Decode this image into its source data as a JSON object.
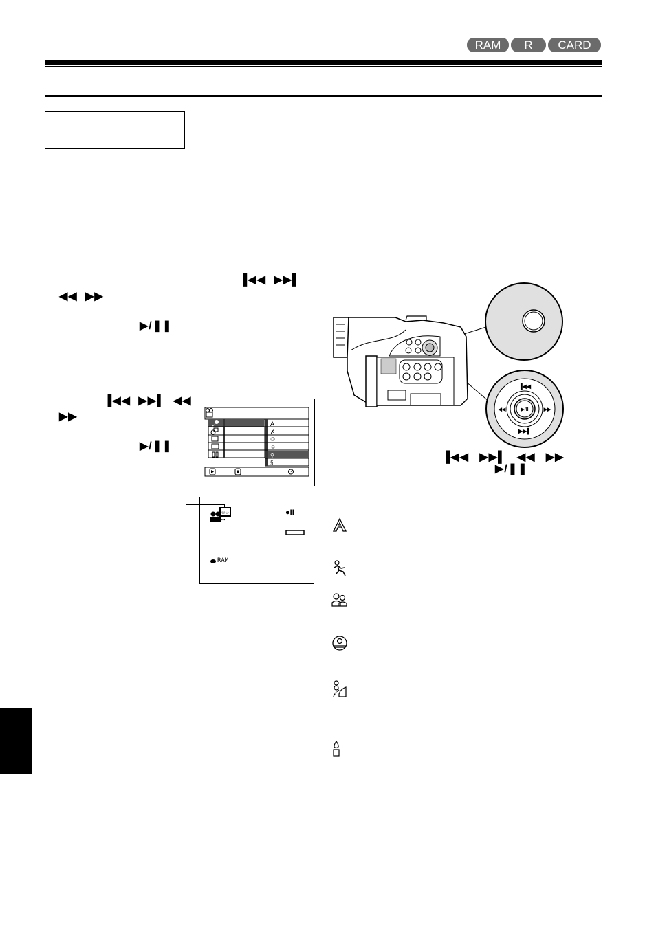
{
  "header": {
    "media_badges": [
      "RAM",
      "R",
      "CARD"
    ]
  },
  "title_box": {
    "text": ""
  },
  "symbols": {
    "skip_back": "⏮",
    "skip_forward": "⏭",
    "rewind": "⏪",
    "fast_forward": "⏩",
    "play_pause": "▶/❚❚"
  },
  "step1": {
    "symbols_line1": [
      "▐◀◀",
      "▶▶▌"
    ],
    "symbols_line2": [
      "◀◀",
      "▶▶"
    ],
    "play_pause": "▶/❚❚"
  },
  "step2": {
    "symbols_line1": [
      "▐◀◀",
      "▶▶▌",
      "◀◀"
    ],
    "symbols_line2": [
      "▶▶"
    ],
    "play_pause": "▶/❚❚"
  },
  "lcd_menu": {
    "header_icon": "camera-icon",
    "left_icons": [
      "mic-icon",
      "camera-settings-icon",
      "timer-icon",
      "display-icon",
      "tools-icon"
    ],
    "right_icons": [
      "auto-icon",
      "sports-icon",
      "portrait-icon",
      "spotlight-icon",
      "surf-snow-icon",
      "low-light-icon"
    ],
    "selected_right_index": 4,
    "footer_icons": [
      "play-icon",
      "stop-icon",
      "timer-icon"
    ]
  },
  "lcd_status": {
    "rec_status": "●II",
    "media_label": "RAM"
  },
  "illustration": {
    "caption_symbols": [
      "▐◀◀",
      "▶▶▌",
      "◀◀",
      "▶▶"
    ],
    "caption_play_pause": "▶/❚❚",
    "joystick_labels": {
      "top": "▐◀◀",
      "bottom": "▶▶▌",
      "left": "◀◀",
      "right": "▶▶",
      "center": "▶/II"
    }
  },
  "program_ae_modes": [
    {
      "icon": "auto-icon",
      "label": ""
    },
    {
      "icon": "sports-icon",
      "label": ""
    },
    {
      "icon": "portrait-icon",
      "label": ""
    },
    {
      "icon": "spotlight-icon",
      "label": ""
    },
    {
      "icon": "surf-snow-icon",
      "label": ""
    },
    {
      "icon": "low-light-icon",
      "label": ""
    }
  ]
}
